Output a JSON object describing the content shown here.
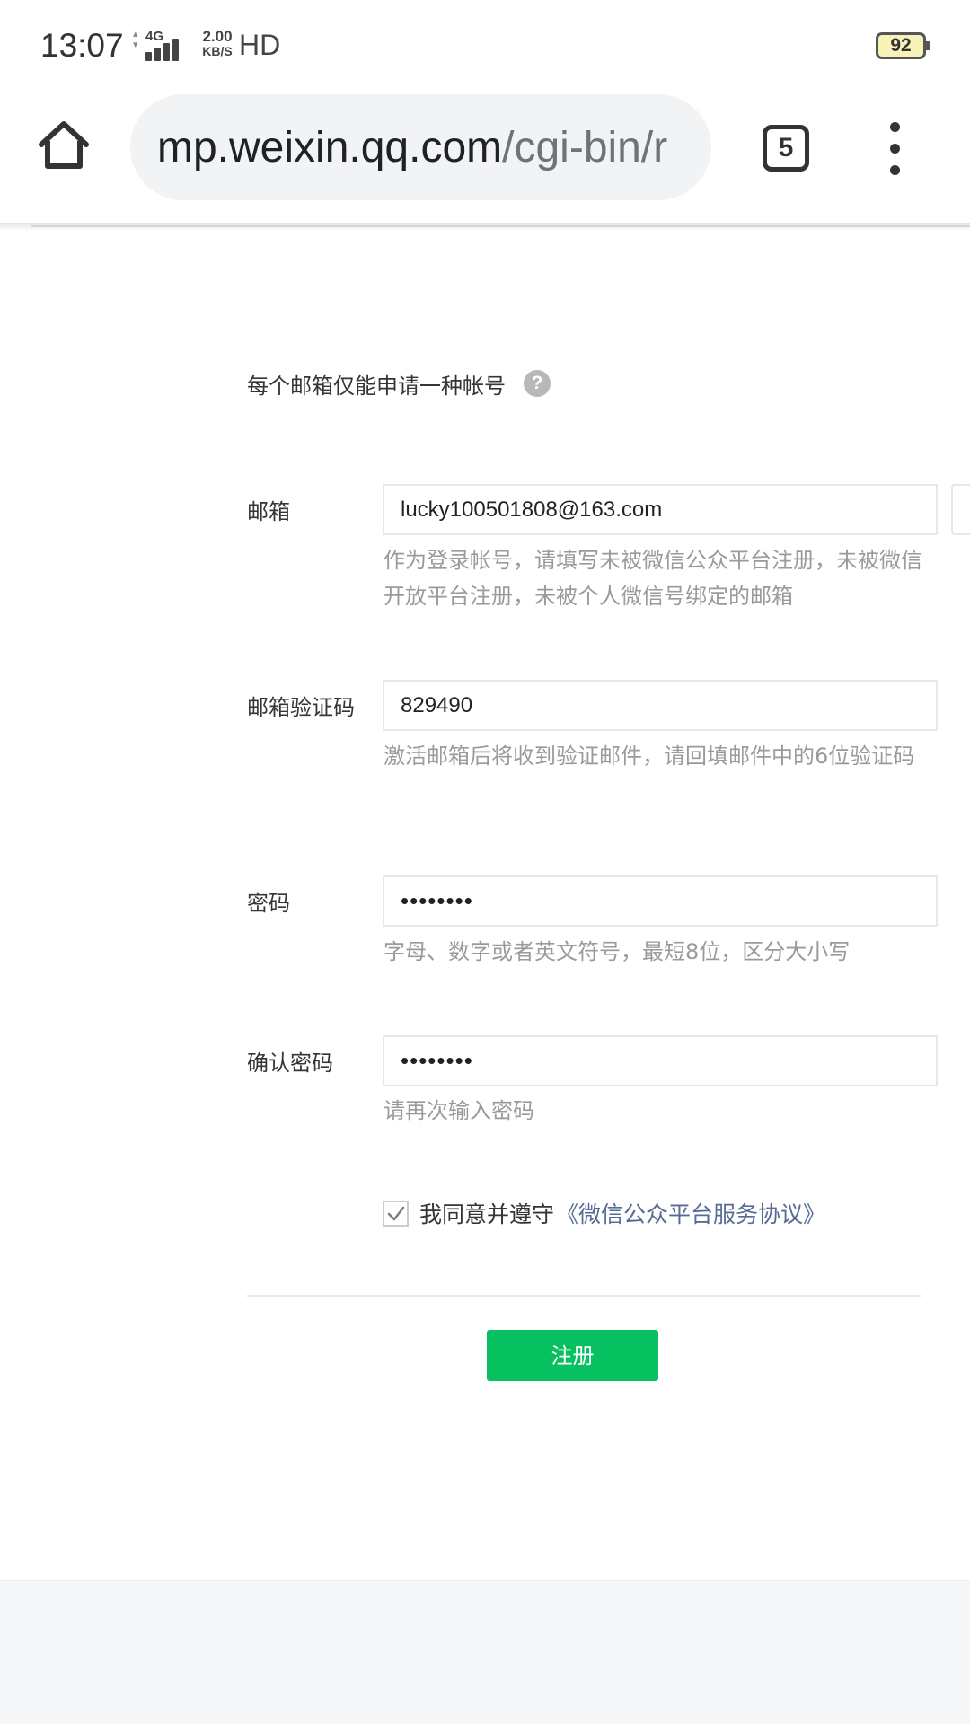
{
  "status_bar": {
    "time": "13:07",
    "network_type": "4G",
    "speed_value": "2.00",
    "speed_unit": "KB/S",
    "hd": "HD",
    "battery": "92"
  },
  "browser": {
    "url_host": "mp.weixin.qq.com",
    "url_path": "/cgi-bin/r",
    "tab_count": "5",
    "icons": {
      "home": "home-icon",
      "menu": "more-vertical-icon"
    }
  },
  "form": {
    "notice": "每个邮箱仅能申请一种帐号",
    "help_icon_glyph": "?",
    "email": {
      "label": "邮箱",
      "value": "lucky100501808@163.com",
      "hint": "作为登录帐号，请填写未被微信公众平台注册，未被微信开放平台注册，未被个人微信号绑定的邮箱"
    },
    "verify_code": {
      "label": "邮箱验证码",
      "value": "829490",
      "hint": "激活邮箱后将收到验证邮件，请回填邮件中的6位验证码"
    },
    "password": {
      "label": "密码",
      "value": "••••••••",
      "hint": "字母、数字或者英文符号，最短8位，区分大小写"
    },
    "confirm_password": {
      "label": "确认密码",
      "value": "••••••••",
      "hint": "请再次输入密码"
    },
    "agreement": {
      "checked": true,
      "text": "我同意并遵守",
      "link": "《微信公众平台服务协议》"
    },
    "submit_label": "注册"
  },
  "colors": {
    "primary_button": "#07c160",
    "link": "#576b95",
    "hint": "#9a9a9a"
  }
}
